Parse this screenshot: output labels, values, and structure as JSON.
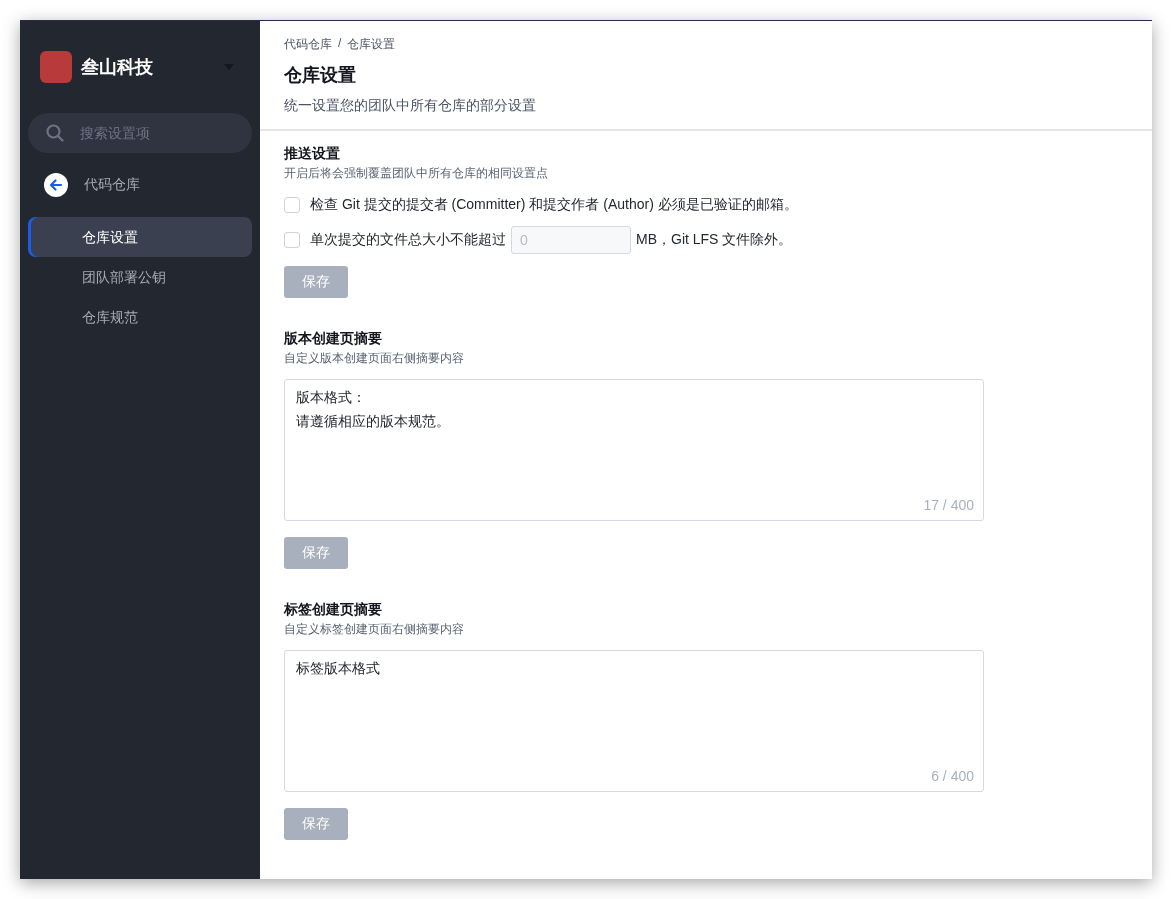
{
  "sidebar": {
    "org_name": "叁山科技",
    "search": {
      "placeholder": "搜索设置项"
    },
    "back_link": "代码仓库",
    "items": [
      {
        "label": "仓库设置",
        "selected": true
      },
      {
        "label": "团队部署公钥",
        "selected": false
      },
      {
        "label": "仓库规范",
        "selected": false
      }
    ]
  },
  "header": {
    "breadcrumb": [
      "代码仓库",
      "仓库设置"
    ],
    "breadcrumb_separator": "/",
    "title": "仓库设置",
    "subtitle": "统一设置您的团队中所有仓库的部分设置"
  },
  "sections": [
    {
      "kind": "checks",
      "title": "推送设置",
      "description": "开启后将会强制覆盖团队中所有仓库的相同设置点",
      "options": [
        {
          "kind": "plain",
          "label": "检查 Git 提交的提交者 (Committer) 和提交作者 (Author) 必须是已验证的邮箱。",
          "checked": false
        },
        {
          "kind": "size",
          "label": "单次提交的文件总大小不能超过",
          "placeholder": "0",
          "suffix": "MB，Git LFS 文件除外。",
          "checked": false
        }
      ],
      "save": {
        "label": "保存",
        "disabled": true
      }
    },
    {
      "kind": "text",
      "title": "版本创建页摘要",
      "description": "自定义版本创建页面右侧摘要内容",
      "lines": [
        "版本格式：",
        "请遵循相应的版本规范。"
      ],
      "counter": "17 / 400",
      "save": {
        "label": "保存",
        "disabled": true
      }
    },
    {
      "kind": "text",
      "title": "标签创建页摘要",
      "description": "自定义标签创建页面右侧摘要内容",
      "lines": [
        "标签版本格式"
      ],
      "counter": "6 / 400",
      "save": {
        "label": "保存",
        "disabled": true
      }
    }
  ]
}
